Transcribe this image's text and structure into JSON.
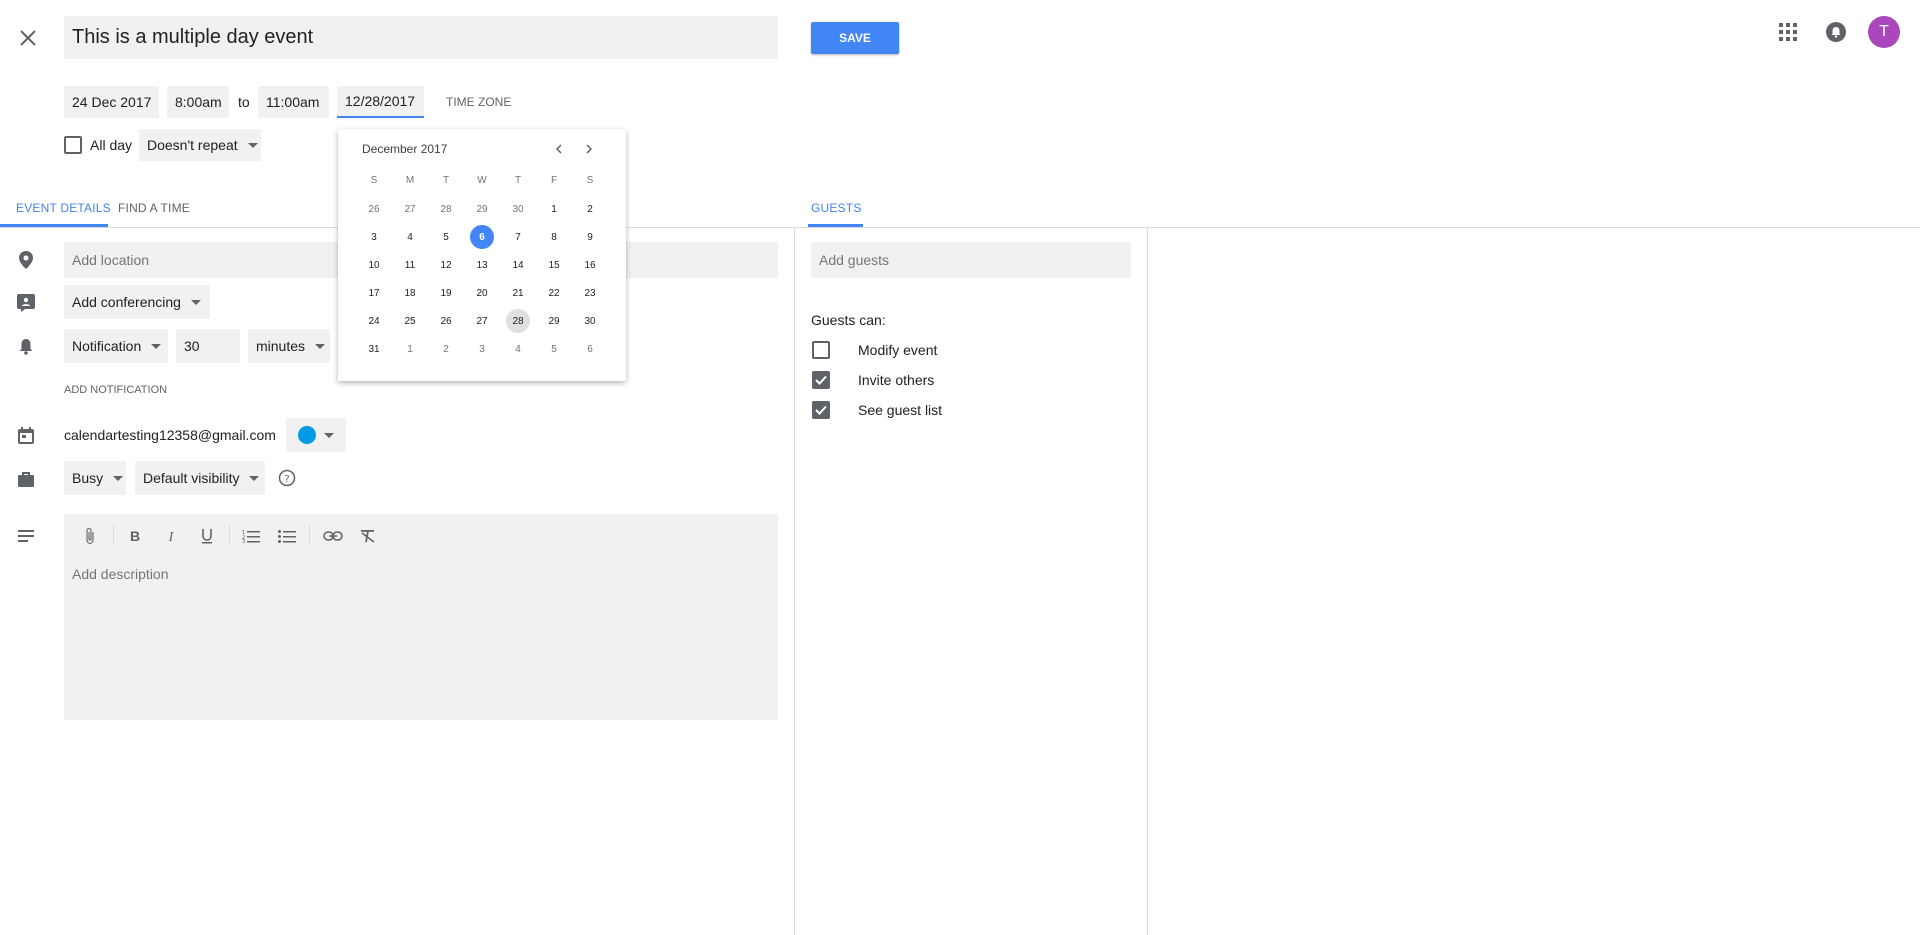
{
  "header": {
    "title_value": "This is a multiple day event",
    "save_label": "SAVE",
    "avatar_letter": "T"
  },
  "datetime": {
    "start_date": "24 Dec 2017",
    "start_time": "8:00am",
    "to_label": "to",
    "end_time": "11:00am",
    "end_date": "12/28/2017",
    "time_zone_label": "TIME ZONE",
    "all_day_label": "All day",
    "repeat_label": "Doesn't repeat"
  },
  "datepicker": {
    "month_label": "December 2017",
    "weekdays": [
      "S",
      "M",
      "T",
      "W",
      "T",
      "F",
      "S"
    ],
    "today": "6",
    "selected": "28",
    "weeks": [
      [
        "26",
        "27",
        "28",
        "29",
        "30",
        "1",
        "2"
      ],
      [
        "3",
        "4",
        "5",
        "6",
        "7",
        "8",
        "9"
      ],
      [
        "10",
        "11",
        "12",
        "13",
        "14",
        "15",
        "16"
      ],
      [
        "17",
        "18",
        "19",
        "20",
        "21",
        "22",
        "23"
      ],
      [
        "24",
        "25",
        "26",
        "27",
        "28",
        "29",
        "30"
      ],
      [
        "31",
        "1",
        "2",
        "3",
        "4",
        "5",
        "6"
      ]
    ]
  },
  "tabs": {
    "event_details": "EVENT DETAILS",
    "find_a_time": "FIND A TIME",
    "guests": "GUESTS"
  },
  "details": {
    "location_placeholder": "Add location",
    "conferencing_label": "Add conferencing",
    "notification_type": "Notification",
    "notification_amount": "30",
    "notification_unit": "minutes",
    "add_notification_label": "ADD NOTIFICATION",
    "calendar_email": "calendartesting12358@gmail.com",
    "calendar_color": "#039be5",
    "busy_label": "Busy",
    "visibility_label": "Default visibility",
    "description_placeholder": "Add description"
  },
  "guests": {
    "add_guests_placeholder": "Add guests",
    "guests_can_label": "Guests can:",
    "permissions": [
      {
        "label": "Modify event",
        "checked": false
      },
      {
        "label": "Invite others",
        "checked": true
      },
      {
        "label": "See guest list",
        "checked": true
      }
    ]
  },
  "colors": {
    "accent": "#4285f4",
    "avatar_bg": "#ab47bc"
  }
}
